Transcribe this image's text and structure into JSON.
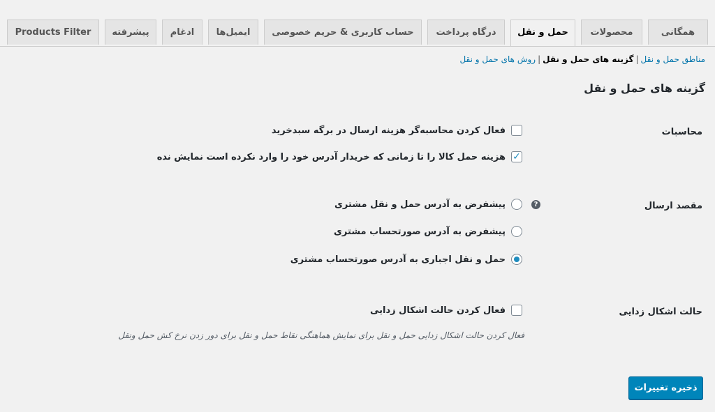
{
  "tabs": [
    {
      "label": "همگانی"
    },
    {
      "label": "محصولات"
    },
    {
      "label": "حمل و نقل",
      "active": true
    },
    {
      "label": "درگاه پرداخت"
    },
    {
      "label": "حساب کاربری & حریم خصوصی"
    },
    {
      "label": "ایمیل‌ها"
    },
    {
      "label": "ادغام"
    },
    {
      "label": "پیشرفته"
    },
    {
      "label": "Products Filter"
    }
  ],
  "subnav": [
    {
      "label": "مناطق حمل و نقل"
    },
    {
      "label": "گزینه های حمل و نقل",
      "current": true
    },
    {
      "label": "روش های حمل و نقل"
    }
  ],
  "subnav_separator": "|",
  "page_title": "گزینه های حمل و نقل",
  "calculations": {
    "label": "محاسبات",
    "options": [
      {
        "label": "فعال کردن محاسبه‌گر هزینه ارسال در برگه سبدخرید",
        "checked": false
      },
      {
        "label": "هزینه حمل کالا را تا زمانی که خریدار آدرس خود را وارد نکرده است نمایش نده",
        "checked": true
      }
    ]
  },
  "destination": {
    "label": "مقصد ارسال",
    "help_icon": "question-circle-icon",
    "options": [
      {
        "label": "پیشفرض به آدرس حمل و نقل مشتری",
        "selected": false
      },
      {
        "label": "پیشفرض به آدرس صورتحساب مشتری",
        "selected": false
      },
      {
        "label": "حمل و نقل اجباری به آدرس صورتحساب مشتری",
        "selected": true
      }
    ]
  },
  "debug": {
    "label": "حالت اشکال زدایی",
    "option": {
      "label": "فعال کردن حالت اشکال زدایی",
      "checked": false
    },
    "description": "فعال کردن حالت اشکال زدایی حمل و نقل برای نمایش هماهنگی نقاط حمل و نقل برای دور زدن نرخ کش حمل ونقل"
  },
  "save_button": "ذخیره تغییرات",
  "colors": {
    "accent": "#0085ba",
    "link": "#0073aa",
    "check": "#1e8cbe",
    "background": "#f1f1f1"
  }
}
